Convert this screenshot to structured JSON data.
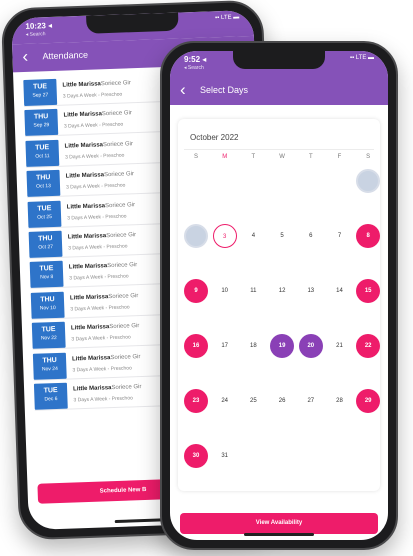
{
  "back_screen": {
    "status": {
      "time": "10:23 ◂",
      "sub": "◂ Search",
      "signal": "▪▪ LTE ▬"
    },
    "header": {
      "back_icon": "‹",
      "title": "Attendance"
    },
    "rows": [
      {
        "dow": "TUE",
        "date": "Sep 27",
        "name": "Little Marissa",
        "school": "Soriece Gir",
        "schedule": "3 Days A Week - Preschoo"
      },
      {
        "dow": "THU",
        "date": "Sep 29",
        "name": "Little Marissa",
        "school": "Soriece Gir",
        "schedule": "3 Days A Week - Preschoo"
      },
      {
        "dow": "TUE",
        "date": "Oct 11",
        "name": "Little Marissa",
        "school": "Soriece Gir",
        "schedule": "3 Days A Week - Preschoo"
      },
      {
        "dow": "THU",
        "date": "Oct 13",
        "name": "Little Marissa",
        "school": "Soriece Gir",
        "schedule": "3 Days A Week - Preschoo"
      },
      {
        "dow": "TUE",
        "date": "Oct 25",
        "name": "Little Marissa",
        "school": "Soriece Gir",
        "schedule": "3 Days A Week - Preschoo"
      },
      {
        "dow": "THU",
        "date": "Oct 27",
        "name": "Little Marissa",
        "school": "Soriece Gir",
        "schedule": "3 Days A Week - Preschoo"
      },
      {
        "dow": "TUE",
        "date": "Nov 8",
        "name": "Little Marissa",
        "school": "Soriece Gir",
        "schedule": "3 Days A Week - Preschoo"
      },
      {
        "dow": "THU",
        "date": "Nov 10",
        "name": "Little Marissa",
        "school": "Soriece Gir",
        "schedule": "3 Days A Week - Preschoo"
      },
      {
        "dow": "TUE",
        "date": "Nov 22",
        "name": "Little Marissa",
        "school": "Soriece Gir",
        "schedule": "3 Days A Week - Preschoo"
      },
      {
        "dow": "THU",
        "date": "Nov 24",
        "name": "Little Marissa",
        "school": "Soriece Gir",
        "schedule": "3 Days A Week - Preschoo"
      },
      {
        "dow": "TUE",
        "date": "Dec 6",
        "name": "Little Marissa",
        "school": "Soriece Gir",
        "schedule": "3 Days A Week - Preschoo"
      }
    ],
    "schedule_button": "Schedule New B"
  },
  "front_screen": {
    "status": {
      "time": "9:52 ◂",
      "sub": "◂ Search",
      "signal": "▪▪ LTE ▬"
    },
    "header": {
      "back_icon": "‹",
      "title": "Select Days"
    },
    "month": "October 2022",
    "weekdays": [
      "S",
      "M",
      "T",
      "W",
      "T",
      "F",
      "S"
    ],
    "weekday_highlight_index": 1,
    "days": [
      {
        "day": "",
        "col": 6,
        "row": 0,
        "state": "gray"
      },
      {
        "day": "",
        "col": 0,
        "row": 1,
        "state": "gray"
      },
      {
        "day": "3",
        "col": 1,
        "row": 1,
        "state": "outline"
      },
      {
        "day": "4",
        "col": 2,
        "row": 1,
        "state": "none"
      },
      {
        "day": "5",
        "col": 3,
        "row": 1,
        "state": "none"
      },
      {
        "day": "6",
        "col": 4,
        "row": 1,
        "state": "none"
      },
      {
        "day": "7",
        "col": 5,
        "row": 1,
        "state": "none"
      },
      {
        "day": "8",
        "col": 6,
        "row": 1,
        "state": "pink"
      },
      {
        "day": "9",
        "col": 0,
        "row": 2,
        "state": "pink"
      },
      {
        "day": "10",
        "col": 1,
        "row": 2,
        "state": "none"
      },
      {
        "day": "11",
        "col": 2,
        "row": 2,
        "state": "none"
      },
      {
        "day": "12",
        "col": 3,
        "row": 2,
        "state": "none"
      },
      {
        "day": "13",
        "col": 4,
        "row": 2,
        "state": "none"
      },
      {
        "day": "14",
        "col": 5,
        "row": 2,
        "state": "none"
      },
      {
        "day": "15",
        "col": 6,
        "row": 2,
        "state": "pink"
      },
      {
        "day": "16",
        "col": 0,
        "row": 3,
        "state": "pink"
      },
      {
        "day": "17",
        "col": 1,
        "row": 3,
        "state": "none"
      },
      {
        "day": "18",
        "col": 2,
        "row": 3,
        "state": "none"
      },
      {
        "day": "19",
        "col": 3,
        "row": 3,
        "state": "purple"
      },
      {
        "day": "20",
        "col": 4,
        "row": 3,
        "state": "purple"
      },
      {
        "day": "21",
        "col": 5,
        "row": 3,
        "state": "none"
      },
      {
        "day": "22",
        "col": 6,
        "row": 3,
        "state": "pink"
      },
      {
        "day": "23",
        "col": 0,
        "row": 4,
        "state": "pink"
      },
      {
        "day": "24",
        "col": 1,
        "row": 4,
        "state": "none"
      },
      {
        "day": "25",
        "col": 2,
        "row": 4,
        "state": "none"
      },
      {
        "day": "26",
        "col": 3,
        "row": 4,
        "state": "none"
      },
      {
        "day": "27",
        "col": 4,
        "row": 4,
        "state": "none"
      },
      {
        "day": "28",
        "col": 5,
        "row": 4,
        "state": "none"
      },
      {
        "day": "29",
        "col": 6,
        "row": 4,
        "state": "pink"
      },
      {
        "day": "30",
        "col": 0,
        "row": 5,
        "state": "pink"
      },
      {
        "day": "31",
        "col": 1,
        "row": 5,
        "state": "none"
      }
    ],
    "view_button": "View Availability"
  },
  "colors": {
    "header_purple": "#8552b8",
    "accent_pink": "#ee1c6a",
    "selected_purple": "#8a40b6",
    "date_blue": "#2e74c9",
    "disabled_gray": "#c9d3e2"
  }
}
